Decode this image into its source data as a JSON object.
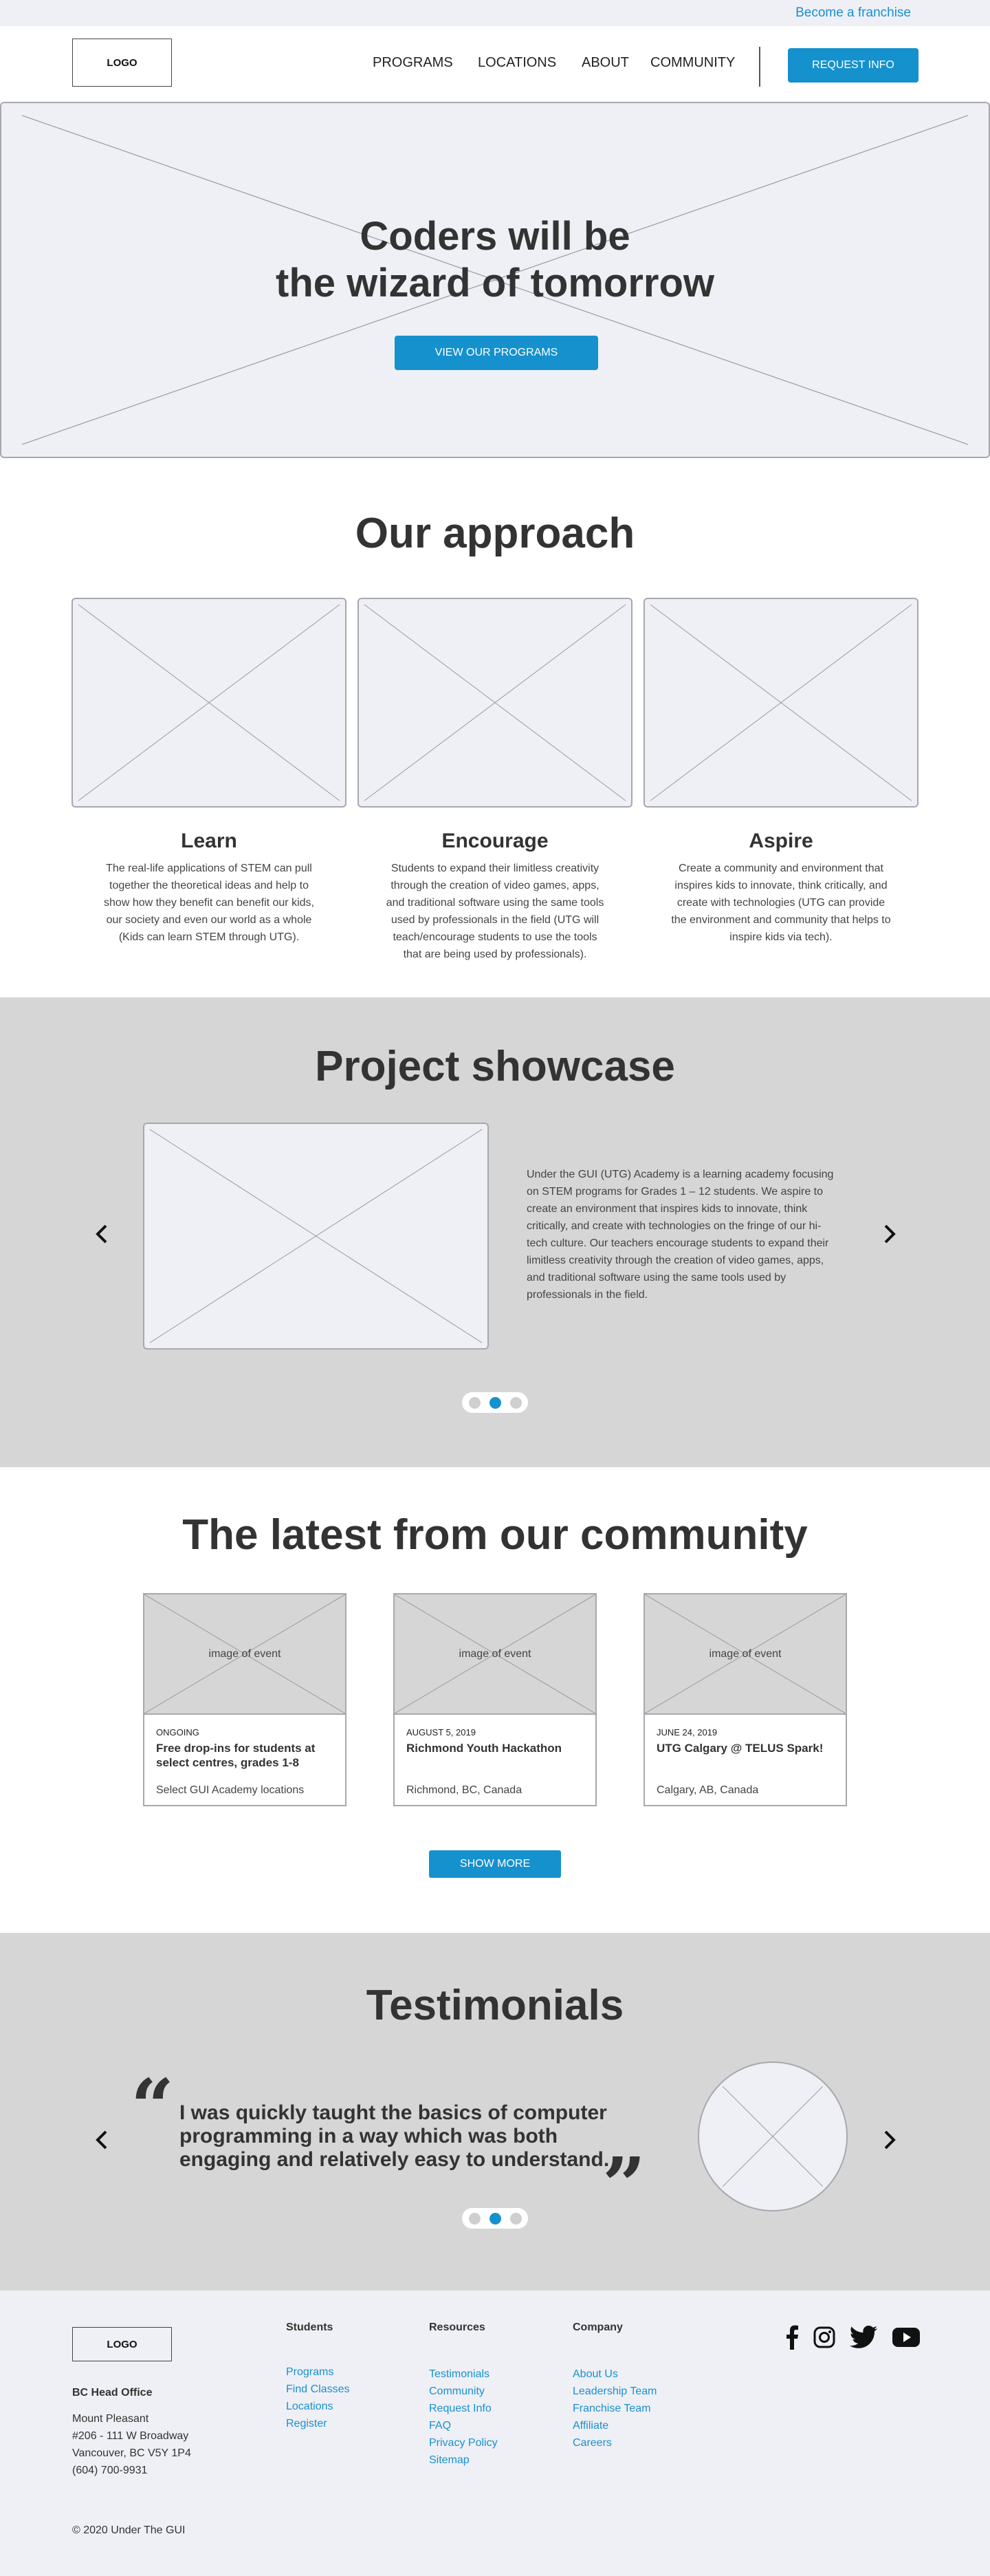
{
  "topbar": {
    "franchise_link": "Become a franchise"
  },
  "header": {
    "logo": "LOGO",
    "nav": [
      {
        "label": "PROGRAMS"
      },
      {
        "label": "LOCATIONS"
      },
      {
        "label": "ABOUT"
      },
      {
        "label": "COMMUNITY"
      }
    ],
    "cta": "REQUEST INFO"
  },
  "hero": {
    "title_line1": "Coders will be",
    "title_line2": "the wizard of tomorrow",
    "button": "VIEW OUR PROGRAMS"
  },
  "approach": {
    "title": "Our approach",
    "cards": [
      {
        "title": "Learn",
        "text": "The real-life applications of STEM can pull together the theoretical ideas and help to show how they benefit can benefit our kids, our society and even our world as a whole (Kids can learn STEM through UTG)."
      },
      {
        "title": "Encourage",
        "text": "Students to expand their limitless creativity through the creation of video games, apps, and traditional software using the same tools used by professionals in the field (UTG will teach/encourage students to use the tools that are being used by professionals)."
      },
      {
        "title": "Aspire",
        "text": "Create a community and environment that inspires kids to innovate, think critically, and create with technologies (UTG can provide the environment and community that helps to inspire kids via tech)."
      }
    ]
  },
  "showcase": {
    "title": "Project showcase",
    "text": "Under the GUI (UTG) Academy is a learning academy focusing on STEM programs for Grades 1 – 12 students. We aspire to create an environment that inspires kids to innovate, think critically, and create with technologies on the fringe of our hi-tech culture. Our teachers encourage students to expand their limitless creativity through the creation of video games, apps, and traditional software using the same tools used by professionals in the field."
  },
  "community": {
    "title": "The latest from our community",
    "events": [
      {
        "image_label": "image of event",
        "date": "ONGOING",
        "title": "Free drop-ins for students at select centres, grades 1-8",
        "location": "Select GUI Academy locations"
      },
      {
        "image_label": "image of event",
        "date": "AUGUST 5, 2019",
        "title": "Richmond Youth Hackathon",
        "location": "Richmond, BC, Canada"
      },
      {
        "image_label": "image of event",
        "date": "JUNE 24, 2019",
        "title": "UTG Calgary @ TELUS Spark!",
        "location": "Calgary, AB, Canada"
      }
    ],
    "show_more": "SHOW MORE"
  },
  "testimonials": {
    "title": "Testimonials",
    "open_quote": "“",
    "close_quote": "”",
    "quote": "I was quickly taught the basics of computer programming in a  way which was both engaging and relatively easy to understand."
  },
  "footer": {
    "logo": "LOGO",
    "office": {
      "title": "BC Head Office",
      "lines": [
        "Mount Pleasant",
        "#206 - 111 W Broadway",
        "Vancouver, BC V5Y 1P4",
        "(604) 700-9931"
      ]
    },
    "columns": [
      {
        "title": "Students",
        "links": [
          "Programs",
          "Find Classes",
          "Locations",
          "Register"
        ]
      },
      {
        "title": "Resources",
        "links": [
          "Testimonials",
          "Community",
          "Request Info",
          "FAQ",
          "Privacy Policy",
          "Sitemap"
        ]
      },
      {
        "title": "Company",
        "links": [
          "About Us",
          "Leadership Team",
          "Franchise Team",
          "Affiliate",
          "Careers"
        ]
      }
    ],
    "social_icons": [
      "facebook-icon",
      "instagram-icon",
      "twitter-icon",
      "youtube-icon"
    ],
    "copyright": "© 2020 Under The GUI"
  },
  "colors": {
    "accent": "#1591cd",
    "link": "#1a8fd0",
    "band": "#d6d6d6",
    "placeholder": "#eef0f5",
    "text": "#333333"
  }
}
